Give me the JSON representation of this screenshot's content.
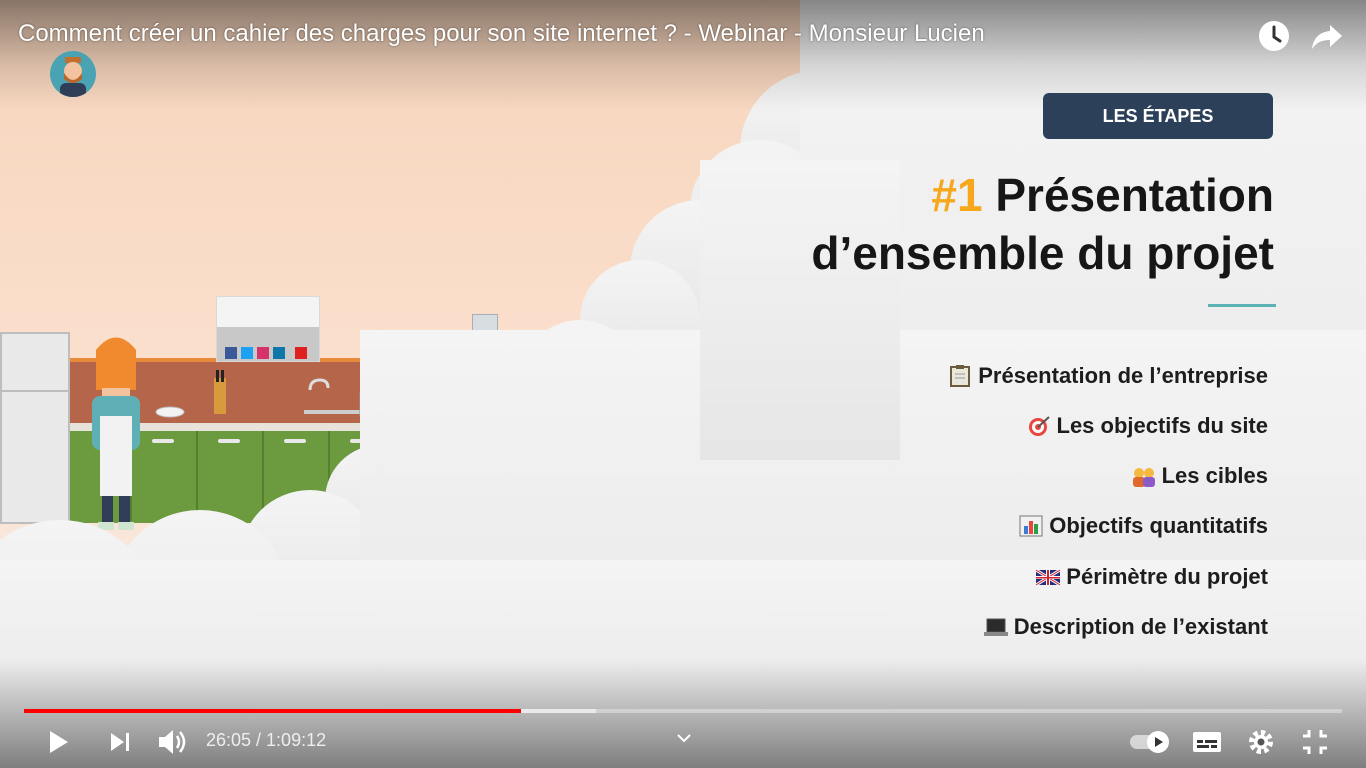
{
  "video": {
    "title": "Comment créer un cahier des charges pour son site internet ? - Webinar - Monsieur Lucien",
    "channel_avatar_icon": "avatar-icon",
    "watch_later_icon": "clock-icon",
    "share_icon": "share-arrow-icon"
  },
  "slide": {
    "badge": "LES ÉTAPES",
    "heading_number": "#1",
    "heading_line1": "Présentation",
    "heading_line2": "d’ensemble du projet",
    "items": [
      {
        "label": "Présentation de l’entreprise",
        "icon": "clipboard-icon"
      },
      {
        "label": "Les objectifs du site",
        "icon": "target-icon"
      },
      {
        "label": "Les cibles",
        "icon": "people-icon"
      },
      {
        "label": "Objectifs quantitatifs",
        "icon": "bar-chart-icon"
      },
      {
        "label": "Périmètre du projet",
        "icon": "uk-flag-icon"
      },
      {
        "label": "Description de l’existant",
        "icon": "laptop-icon"
      }
    ]
  },
  "player": {
    "current_time": "26:05",
    "separator": " / ",
    "duration": "1:09:12",
    "time_display": "26:05 / 1:09:12",
    "progress_played_fraction": 0.377,
    "progress_buffered_fraction": 0.434,
    "autoplay_on": true,
    "colors": {
      "played": "#ff0000",
      "badge": "#2c4059",
      "accent_number": "#f6a71c",
      "accent_line": "#5cb3b4"
    }
  }
}
